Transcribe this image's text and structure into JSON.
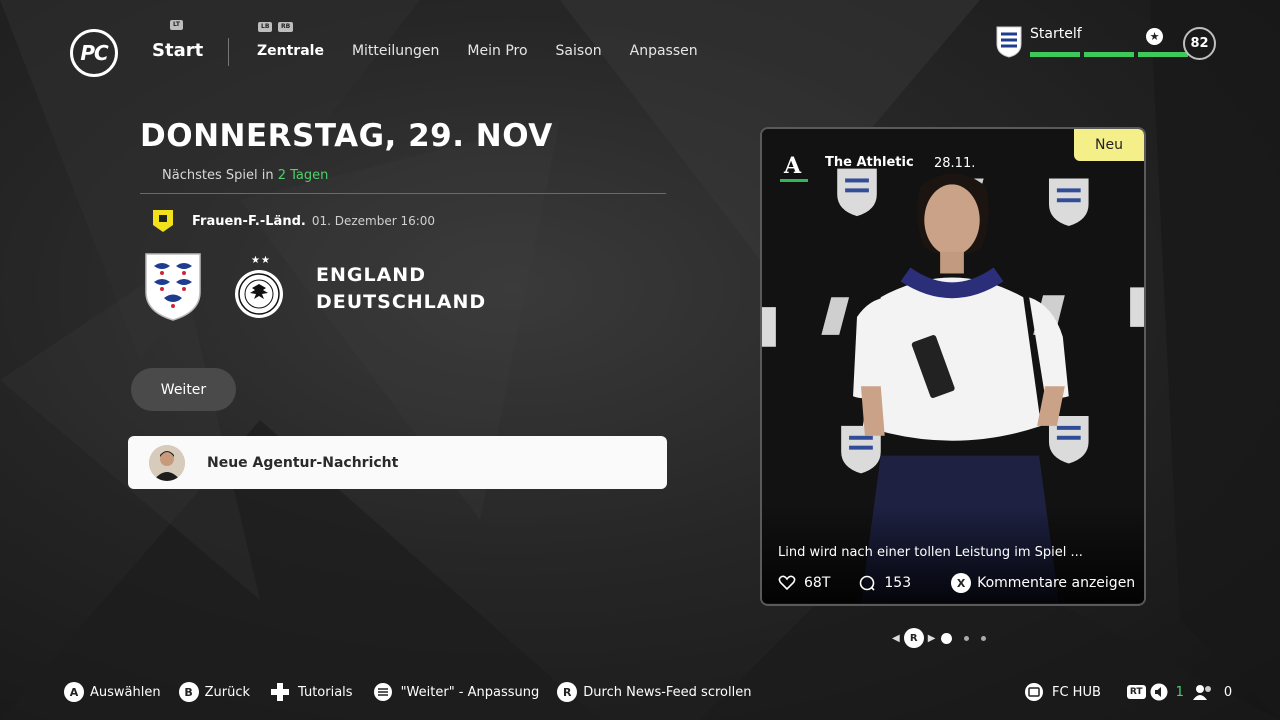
{
  "header": {
    "logo": "PC",
    "start_label": "Start",
    "lt_hint": "LT",
    "lb_hint": "LB",
    "rb_hint": "RB",
    "tabs": [
      {
        "label": "Zentrale",
        "active": true
      },
      {
        "label": "Mitteilungen",
        "active": false
      },
      {
        "label": "Mein Pro",
        "active": false
      },
      {
        "label": "Saison",
        "active": false
      },
      {
        "label": "Anpassen",
        "active": false
      }
    ],
    "club": {
      "name": "Startelf",
      "bar_color": "#3ec95a"
    },
    "ovr": "82"
  },
  "match": {
    "date_title": "DONNERSTAG, 29. NOV",
    "next_prefix": "Nächstes Spiel in",
    "next_value": "2 Tagen",
    "competition": "Frauen-F.-Länd.",
    "kickoff": "01. Dezember 16:00",
    "home_team": "ENGLAND",
    "away_team": "DEUTSCHLAND",
    "accent": "#4fd06a"
  },
  "actions": {
    "continue_label": "Weiter",
    "agency_news_label": "Neue Agentur-Nachricht"
  },
  "feed": {
    "badge": "Neu",
    "source": "The Athletic",
    "date": "28.11.",
    "headline": "Lind wird nach einer tollen Leistung im Spiel ...",
    "likes": "68T",
    "comments": "153",
    "comments_action": "Kommentare anzeigen",
    "badge_color": "#f5ef8a"
  },
  "pager": {
    "button": "R"
  },
  "bottom_bar": {
    "hints": [
      {
        "button": "A",
        "label": "Auswählen"
      },
      {
        "button": "B",
        "label": "Zurück"
      },
      {
        "icon": "dpad-icon",
        "label": "Tutorials"
      },
      {
        "icon": "menu-icon",
        "label": "\"Weiter\" - Anpassung"
      },
      {
        "button": "R",
        "label": "Durch News-Feed scrollen"
      }
    ],
    "fc_hub": "FC HUB",
    "rt": "RT",
    "voice_count": "1",
    "party_count": "0"
  }
}
